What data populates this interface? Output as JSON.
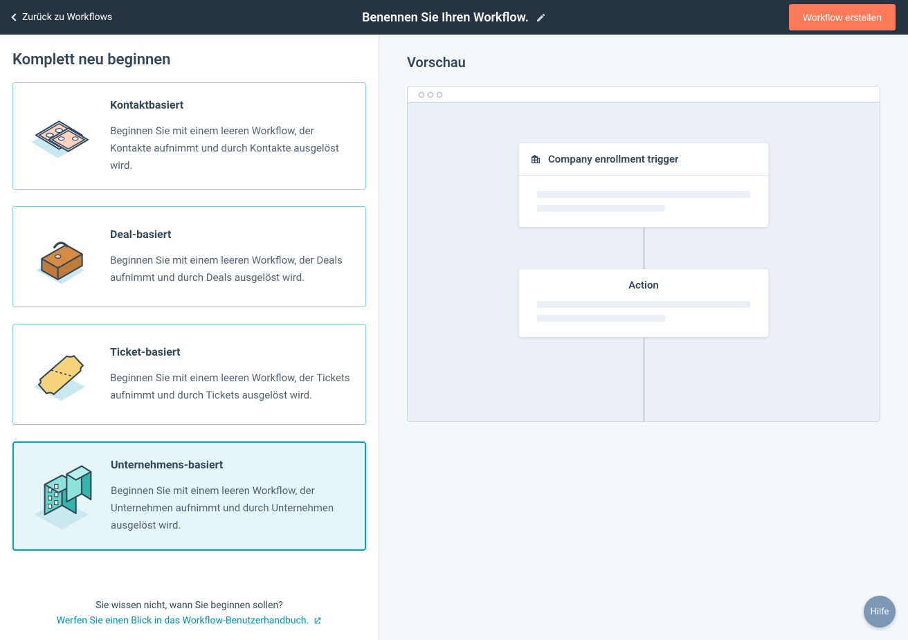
{
  "header": {
    "back_label": "Zurück zu Workflows",
    "title": "Benennen Sie Ihren Workflow.",
    "create_button": "Workflow erstellen"
  },
  "left": {
    "section_title": "Komplett neu beginnen",
    "cards": [
      {
        "title": "Kontaktbasiert",
        "desc": "Beginnen Sie mit einem leeren Workflow, der Kontakte aufnimmt und durch Kontakte ausgelöst wird.",
        "selected": false
      },
      {
        "title": "Deal-basiert",
        "desc": "Beginnen Sie mit einem leeren Workflow, der Deals aufnimmt und durch Deals ausgelöst wird.",
        "selected": false
      },
      {
        "title": "Ticket-basiert",
        "desc": "Beginnen Sie mit einem leeren Workflow, der Tickets aufnimmt und durch Tickets ausgelöst wird.",
        "selected": false
      },
      {
        "title": "Unternehmens-basiert",
        "desc": "Beginnen Sie mit einem leeren Workflow, der Unternehmen aufnimmt und durch Unternehmen ausgelöst wird.",
        "selected": true
      }
    ],
    "help_question": "Sie wissen nicht, wann Sie beginnen sollen?",
    "help_link": "Werfen Sie einen Blick in das Workflow-Benutzerhandbuch."
  },
  "preview": {
    "title": "Vorschau",
    "trigger_title": "Company enrollment trigger",
    "action_title": "Action"
  },
  "help_bubble": "Hilfe"
}
